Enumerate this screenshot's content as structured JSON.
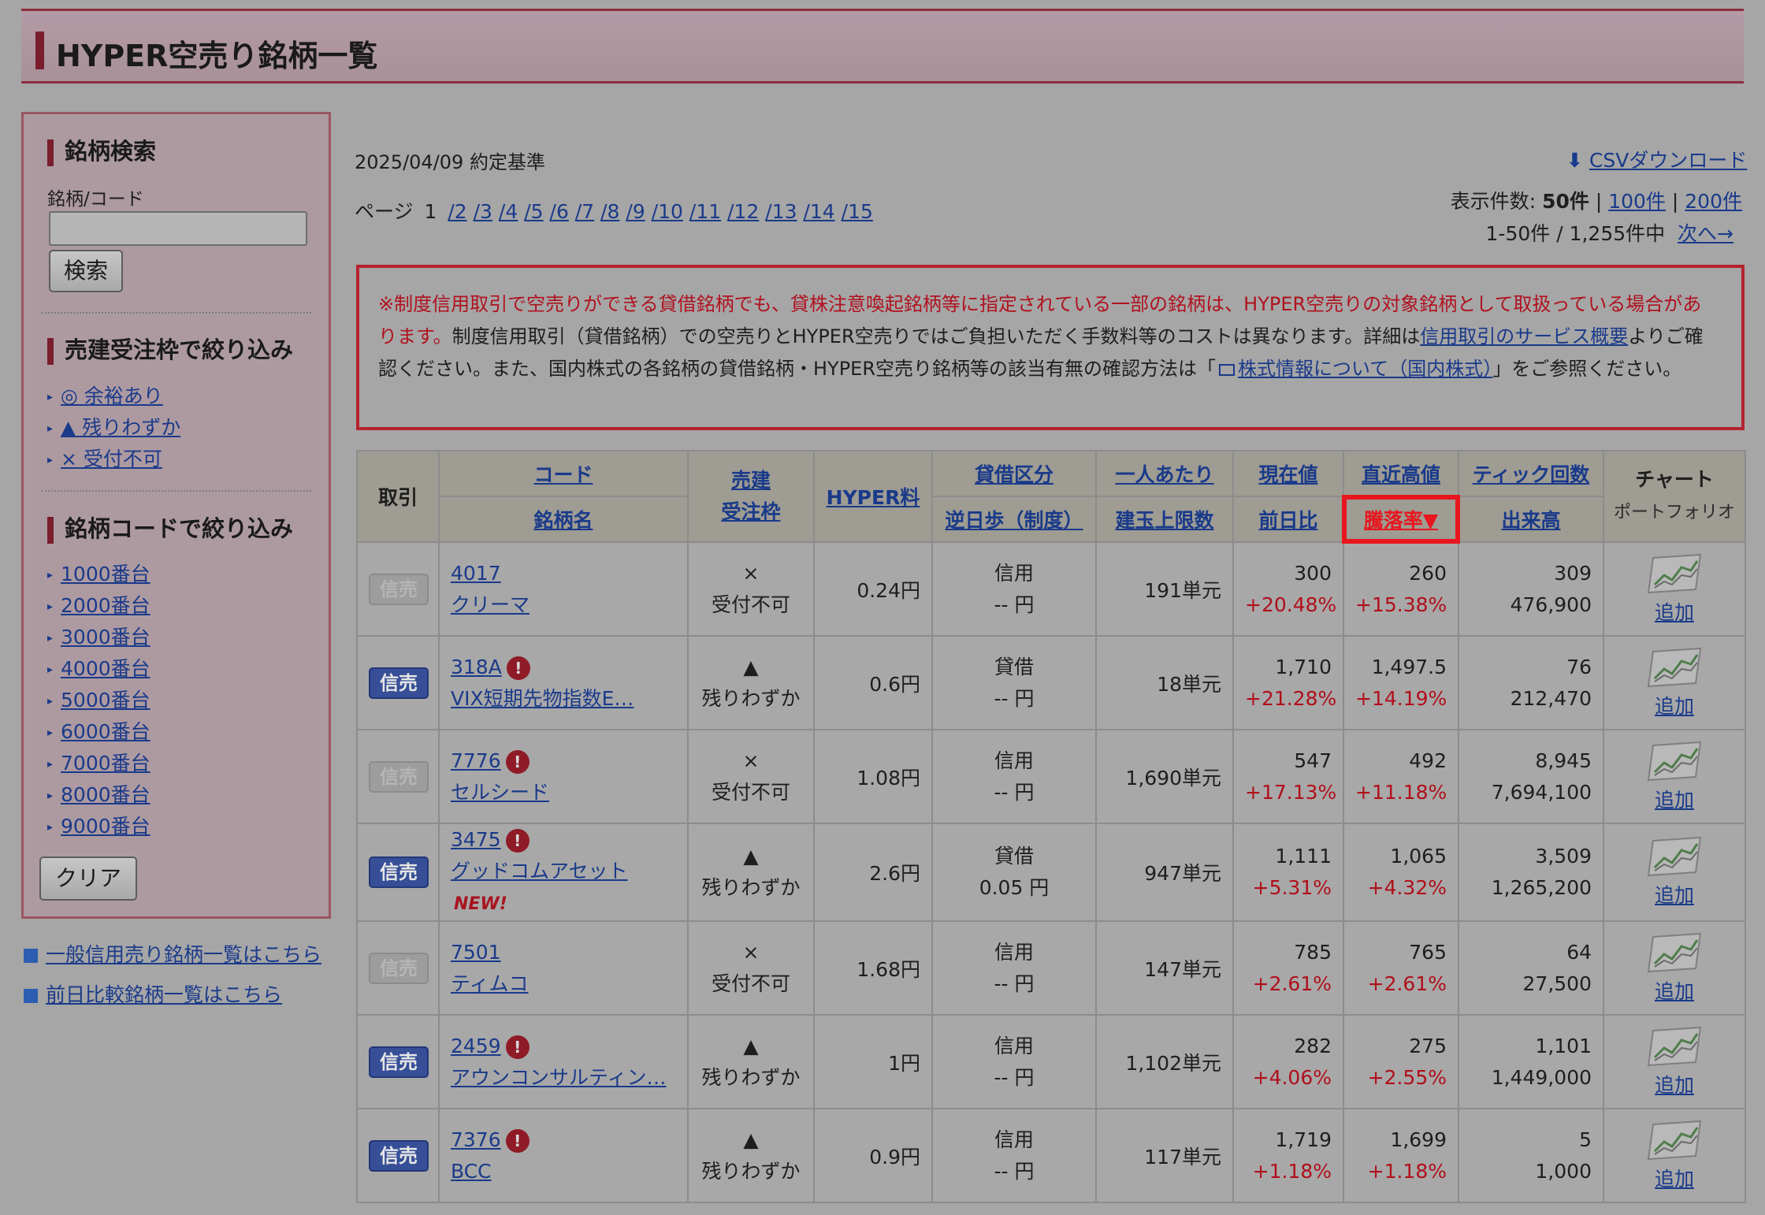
{
  "page_title": "HYPER空売り銘柄一覧",
  "sidebar": {
    "search_heading": "銘柄検索",
    "code_label": "銘柄/コード",
    "search_button": "検索",
    "order_heading": "売建受注枠で絞り込み",
    "order_filters": [
      "◎ 余裕あり",
      "▲ 残りわずか",
      "× 受付不可"
    ],
    "code_heading": "銘柄コードで絞り込み",
    "code_filters": [
      "1000番台",
      "2000番台",
      "3000番台",
      "4000番台",
      "5000番台",
      "6000番台",
      "7000番台",
      "8000番台",
      "9000番台"
    ],
    "clear_button": "クリア"
  },
  "bottom_links": [
    "一般信用売り銘柄一覧はこちら",
    "前日比較銘柄一覧はこちら"
  ],
  "date_basis": "2025/04/09  約定基準",
  "pager": {
    "label": "ページ",
    "current": "1",
    "pages": [
      "/2",
      "/3",
      "/4",
      "/5",
      "/6",
      "/7",
      "/8",
      "/9",
      "/10",
      "/11",
      "/12",
      "/13",
      "/14",
      "/15"
    ]
  },
  "csv_link": "CSVダウンロード",
  "display_count": {
    "label": "表示件数:",
    "current": "50件",
    "option_100": "100件",
    "option_200": "200件",
    "sep": "|"
  },
  "range_text": "1-50件  /  1,255件中",
  "next_link": "次へ→",
  "notice": {
    "red": "※制度信用取引で空売りができる貸借銘柄でも、貸株注意喚起銘柄等に指定されている一部の銘柄は、HYPER空売りの対象銘柄として取扱っている場合があります。",
    "text1": "制度信用取引（貸借銘柄）での空売りとHYPER空売りではご負担いただく手数料等のコストは異なります。詳細は",
    "link1": "信用取引のサービス概要",
    "text2": "よりご確認ください。また、国内株式の各銘柄の貸借銘柄・HYPER空売り銘柄等の該当有無の確認方法は「",
    "link2": "株式情報について（国内株式）",
    "text3": "」をご参照ください。"
  },
  "table": {
    "headers": {
      "trade": "取引",
      "code": "コード",
      "name": "銘柄名",
      "order1": "売建",
      "order2": "受注枠",
      "hyper_fee": "HYPER料",
      "lending": "貸借区分",
      "reverse_fee": "逆日歩（制度）",
      "per_person": "一人あたり",
      "limit": "建玉上限数",
      "price": "現在値",
      "change": "前日比",
      "recent_high": "直近高値",
      "rise_rate": "騰落率▼",
      "tick": "ティック回数",
      "volume": "出来高",
      "chart": "チャート",
      "portfolio": "ポートフォリオ"
    },
    "badge_label": "信売",
    "add_label": "追加",
    "new_label": "NEW!",
    "warn_glyph": "!",
    "rows": [
      {
        "enabled": false,
        "code": "4017",
        "warn": false,
        "name": "クリーマ",
        "new": false,
        "order_mark": "×",
        "order_text": "受付不可",
        "hyper_fee": "0.24円",
        "lending": "信用",
        "reverse": "-- 円",
        "limit": "191単元",
        "price": "300",
        "change": "+20.48%",
        "high": "260",
        "rate": "+15.38%",
        "tick": "309",
        "volume": "476,900"
      },
      {
        "enabled": true,
        "code": "318A",
        "warn": true,
        "name": "VIX短期先物指数E…",
        "new": false,
        "order_mark": "▲",
        "order_text": "残りわずか",
        "hyper_fee": "0.6円",
        "lending": "貸借",
        "reverse": "-- 円",
        "limit": "18単元",
        "price": "1,710",
        "change": "+21.28%",
        "high": "1,497.5",
        "rate": "+14.19%",
        "tick": "76",
        "volume": "212,470"
      },
      {
        "enabled": false,
        "code": "7776",
        "warn": true,
        "name": "セルシード",
        "new": false,
        "order_mark": "×",
        "order_text": "受付不可",
        "hyper_fee": "1.08円",
        "lending": "信用",
        "reverse": "-- 円",
        "limit": "1,690単元",
        "price": "547",
        "change": "+17.13%",
        "high": "492",
        "rate": "+11.18%",
        "tick": "8,945",
        "volume": "7,694,100"
      },
      {
        "enabled": true,
        "code": "3475",
        "warn": true,
        "name": "グッドコムアセット",
        "new": true,
        "order_mark": "▲",
        "order_text": "残りわずか",
        "hyper_fee": "2.6円",
        "lending": "貸借",
        "reverse": "0.05 円",
        "limit": "947単元",
        "price": "1,111",
        "change": "+5.31%",
        "high": "1,065",
        "rate": "+4.32%",
        "tick": "3,509",
        "volume": "1,265,200"
      },
      {
        "enabled": false,
        "code": "7501",
        "warn": false,
        "name": "ティムコ",
        "new": false,
        "order_mark": "×",
        "order_text": "受付不可",
        "hyper_fee": "1.68円",
        "lending": "信用",
        "reverse": "-- 円",
        "limit": "147単元",
        "price": "785",
        "change": "+2.61%",
        "high": "765",
        "rate": "+2.61%",
        "tick": "64",
        "volume": "27,500"
      },
      {
        "enabled": true,
        "code": "2459",
        "warn": true,
        "name": "アウンコンサルティン…",
        "new": false,
        "order_mark": "▲",
        "order_text": "残りわずか",
        "hyper_fee": "1円",
        "lending": "信用",
        "reverse": "-- 円",
        "limit": "1,102単元",
        "price": "282",
        "change": "+4.06%",
        "high": "275",
        "rate": "+2.55%",
        "tick": "1,101",
        "volume": "1,449,000"
      },
      {
        "enabled": true,
        "code": "7376",
        "warn": true,
        "name": "BCC",
        "new": false,
        "order_mark": "▲",
        "order_text": "残りわずか",
        "hyper_fee": "0.9円",
        "lending": "信用",
        "reverse": "-- 円",
        "limit": "117単元",
        "price": "1,719",
        "change": "+1.18%",
        "high": "1,699",
        "rate": "+1.18%",
        "tick": "5",
        "volume": "1,000"
      }
    ]
  }
}
